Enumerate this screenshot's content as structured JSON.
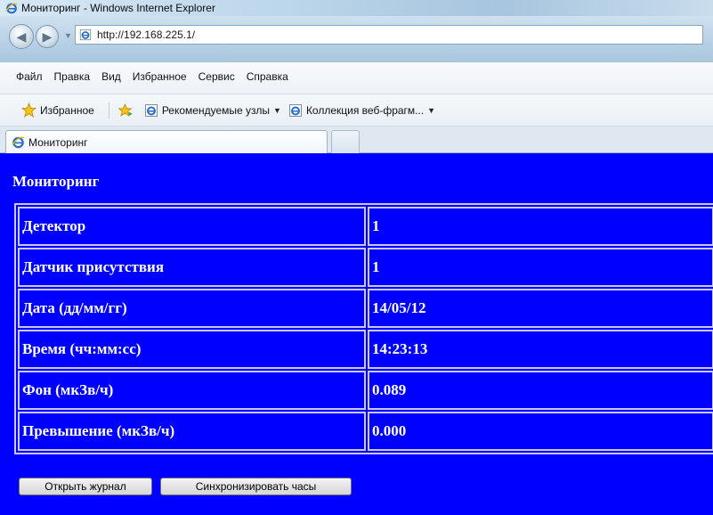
{
  "window": {
    "title": "Мониторинг - Windows Internet Explorer"
  },
  "address": {
    "url": "http://192.168.225.1/"
  },
  "menu": {
    "items": [
      "Файл",
      "Правка",
      "Вид",
      "Избранное",
      "Сервис",
      "Справка"
    ]
  },
  "favorites": {
    "label": "Избранное",
    "links": [
      {
        "label": "Рекомендуемые узлы"
      },
      {
        "label": "Коллекция веб-фрагм..."
      }
    ]
  },
  "tabs": [
    {
      "label": "Мониторинг"
    }
  ],
  "page": {
    "heading": "Мониторинг",
    "rows": [
      {
        "label": "Детектор",
        "value": "1"
      },
      {
        "label": "Датчик присутствия",
        "value": "1"
      },
      {
        "label": "Дата (дд/мм/гг)",
        "value": "14/05/12"
      },
      {
        "label": "Время (чч:мм:сс)",
        "value": "14:23:13"
      },
      {
        "label": "Фон (мкЗв/ч)",
        "value": "0.089"
      },
      {
        "label": "Превышение (мкЗв/ч)",
        "value": "0.000"
      }
    ],
    "buttons": {
      "open_log": "Открыть журнал",
      "sync_clock": "Синхронизировать часы"
    }
  },
  "colors": {
    "page_background": "#0000ff",
    "table_border": "#c8c8ff",
    "text": "#ffffff"
  },
  "icons": {
    "window": "ie-logo-icon",
    "address": "page-icon",
    "favorites": "star-icon",
    "add_favorite": "add-favorite-icon",
    "links": "ie-page-icon"
  }
}
